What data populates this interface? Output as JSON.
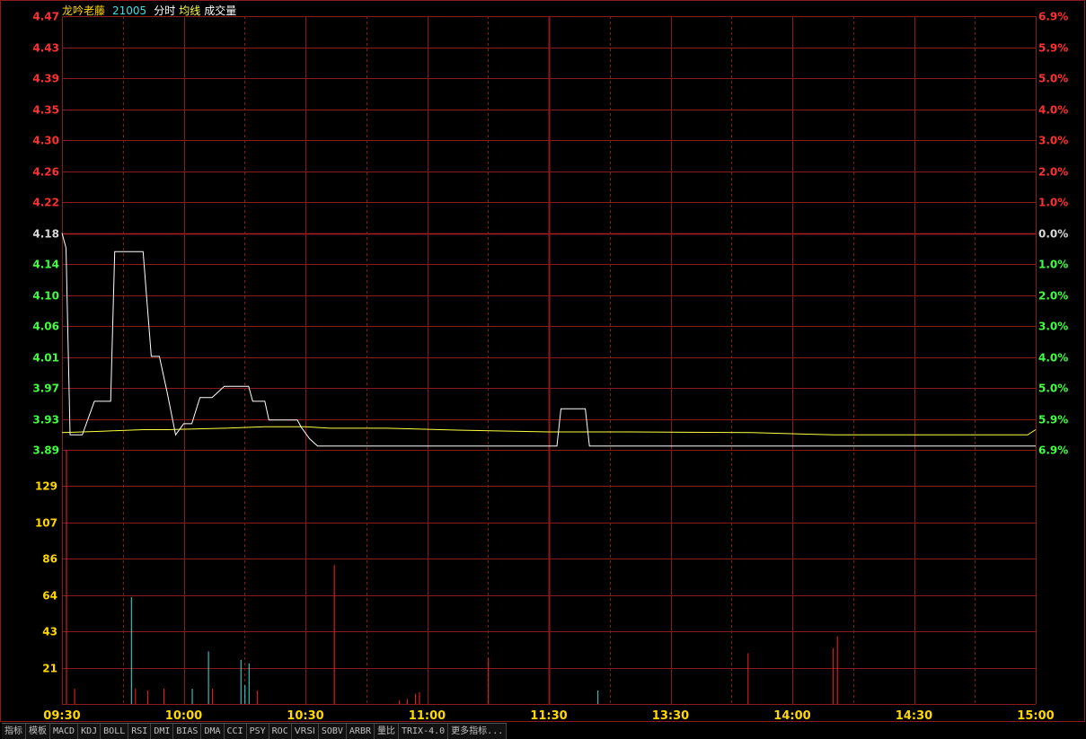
{
  "header": {
    "name": "龙吟老藤",
    "code": "21005",
    "label_time": "分时",
    "label_avg": "均线",
    "label_vol": "成交量"
  },
  "colors": {
    "grid": "#8b1a1a",
    "up": "#ff3030",
    "down": "#40ff40",
    "flat": "#d8d8d8",
    "price_line": "#ffffff",
    "avg_line": "#ffff40",
    "vol_axis": "#ffd700",
    "vol_down": "#40e0e0",
    "title_name": "#ffd700",
    "title_code": "#40e0e0"
  },
  "price_axis": {
    "left": [
      "4.47",
      "4.43",
      "4.39",
      "4.35",
      "4.30",
      "4.26",
      "4.22",
      "4.18",
      "4.14",
      "4.10",
      "4.06",
      "4.01",
      "3.97",
      "3.93",
      "3.89"
    ],
    "right": [
      "6.9%",
      "5.9%",
      "5.0%",
      "4.0%",
      "3.0%",
      "2.0%",
      "1.0%",
      "0.0%",
      "1.0%",
      "2.0%",
      "3.0%",
      "4.0%",
      "5.0%",
      "5.9%",
      "6.9%"
    ],
    "prev_close": 4.18,
    "min": 3.89,
    "max": 4.47
  },
  "volume_axis": {
    "labels": [
      "129",
      "107",
      "86",
      "64",
      "43",
      "21"
    ],
    "max": 150
  },
  "time_axis": [
    "09:30",
    "10:00",
    "10:30",
    "11:00",
    "11:30",
    "13:30",
    "14:00",
    "14:30",
    "15:00"
  ],
  "chart_data": {
    "type": "line",
    "x_unit": "trading minute (0=09:30, 120=11:30/13:00, 240=15:00)",
    "price": [
      [
        0,
        4.18
      ],
      [
        1,
        4.16
      ],
      [
        2,
        3.91
      ],
      [
        5,
        3.91
      ],
      [
        8,
        3.955
      ],
      [
        10,
        3.955
      ],
      [
        12,
        3.955
      ],
      [
        13,
        4.155
      ],
      [
        18,
        4.155
      ],
      [
        20,
        4.155
      ],
      [
        22,
        4.015
      ],
      [
        24,
        4.015
      ],
      [
        26,
        3.965
      ],
      [
        28,
        3.91
      ],
      [
        30,
        3.925
      ],
      [
        32,
        3.925
      ],
      [
        34,
        3.96
      ],
      [
        37,
        3.96
      ],
      [
        40,
        3.975
      ],
      [
        44,
        3.975
      ],
      [
        46,
        3.975
      ],
      [
        47,
        3.955
      ],
      [
        50,
        3.955
      ],
      [
        51,
        3.93
      ],
      [
        56,
        3.93
      ],
      [
        58,
        3.93
      ],
      [
        59,
        3.92
      ],
      [
        61,
        3.905
      ],
      [
        63,
        3.895
      ],
      [
        96,
        3.895
      ],
      [
        122,
        3.895
      ],
      [
        123,
        3.945
      ],
      [
        129,
        3.945
      ],
      [
        130,
        3.895
      ],
      [
        240,
        3.895
      ]
    ],
    "avg": [
      [
        0,
        3.913
      ],
      [
        5,
        3.914
      ],
      [
        10,
        3.915
      ],
      [
        20,
        3.917
      ],
      [
        26,
        3.917
      ],
      [
        40,
        3.919
      ],
      [
        50,
        3.921
      ],
      [
        60,
        3.921
      ],
      [
        66,
        3.919
      ],
      [
        80,
        3.919
      ],
      [
        100,
        3.916
      ],
      [
        120,
        3.914
      ],
      [
        140,
        3.914
      ],
      [
        170,
        3.913
      ],
      [
        190,
        3.91
      ],
      [
        220,
        3.91
      ],
      [
        238,
        3.91
      ],
      [
        240,
        3.917
      ]
    ],
    "volume_up": [
      [
        1,
        150
      ],
      [
        3,
        9
      ],
      [
        18,
        9
      ],
      [
        21,
        8
      ],
      [
        25,
        9
      ],
      [
        37,
        9
      ],
      [
        48,
        8
      ],
      [
        67,
        82
      ],
      [
        83,
        2
      ],
      [
        85,
        3
      ],
      [
        87,
        6
      ],
      [
        88,
        7
      ],
      [
        105,
        27
      ],
      [
        169,
        30
      ],
      [
        190,
        33
      ],
      [
        191,
        40
      ]
    ],
    "volume_down": [
      [
        17,
        63
      ],
      [
        32,
        9
      ],
      [
        36,
        31
      ],
      [
        44,
        26
      ],
      [
        45,
        11
      ],
      [
        46,
        24
      ],
      [
        132,
        8
      ]
    ]
  },
  "toolbar": [
    "指标",
    "模板",
    "MACD",
    "KDJ",
    "BOLL",
    "RSI",
    "DMI",
    "BIAS",
    "DMA",
    "CCI",
    "PSY",
    "ROC",
    "VRSI",
    "SOBV",
    "ARBR",
    "量比",
    "TRIX-4.0",
    "更多指标..."
  ]
}
